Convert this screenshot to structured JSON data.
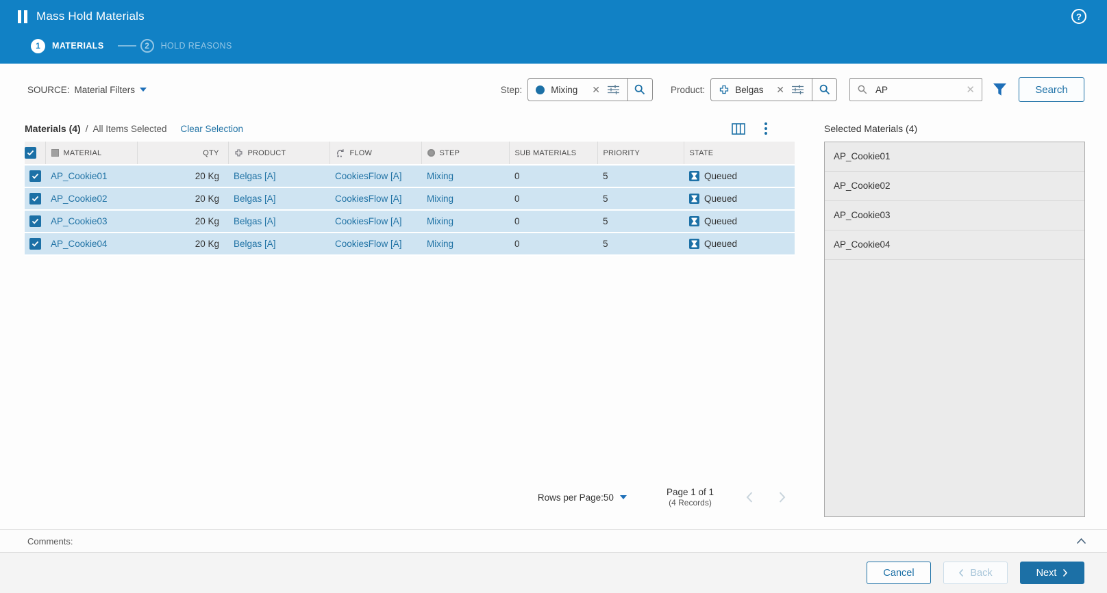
{
  "header": {
    "title": "Mass Hold Materials",
    "steps": [
      {
        "number": "1",
        "label": "MATERIALS"
      },
      {
        "number": "2",
        "label": "HOLD REASONS"
      }
    ],
    "help": "?"
  },
  "filters": {
    "source_label": "SOURCE:",
    "source_value": "Material Filters",
    "step_label": "Step:",
    "step_chip": "Mixing",
    "product_label": "Product:",
    "product_chip": "Belgas",
    "search_input_value": "AP",
    "search_button_label": "Search"
  },
  "materials_bar": {
    "title": "Materials (4)",
    "divider": "/",
    "status": "All Items Selected",
    "clear": "Clear Selection"
  },
  "table": {
    "columns": [
      "MATERIAL",
      "QTY",
      "PRODUCT",
      "FLOW",
      "STEP",
      "SUB MATERIALS",
      "PRIORITY",
      "STATE"
    ],
    "rows": [
      {
        "material": "AP_Cookie01",
        "qty": "20 Kg",
        "product": "Belgas [A]",
        "flow": "CookiesFlow [A]",
        "step": "Mixing",
        "sub_materials": "0",
        "priority": "5",
        "state": "Queued"
      },
      {
        "material": "AP_Cookie02",
        "qty": "20 Kg",
        "product": "Belgas [A]",
        "flow": "CookiesFlow [A]",
        "step": "Mixing",
        "sub_materials": "0",
        "priority": "5",
        "state": "Queued"
      },
      {
        "material": "AP_Cookie03",
        "qty": "20 Kg",
        "product": "Belgas [A]",
        "flow": "CookiesFlow [A]",
        "step": "Mixing",
        "sub_materials": "0",
        "priority": "5",
        "state": "Queued"
      },
      {
        "material": "AP_Cookie04",
        "qty": "20 Kg",
        "product": "Belgas [A]",
        "flow": "CookiesFlow [A]",
        "step": "Mixing",
        "sub_materials": "0",
        "priority": "5",
        "state": "Queued"
      }
    ]
  },
  "pagination": {
    "rows_per_page_label": "Rows per Page:",
    "rows_per_page_value": "50",
    "page_info": "Page 1 of 1",
    "records_info": "(4 Records)"
  },
  "selected_panel": {
    "title": "Selected Materials (4)",
    "items": [
      "AP_Cookie01",
      "AP_Cookie02",
      "AP_Cookie03",
      "AP_Cookie04"
    ]
  },
  "comments": {
    "label": "Comments:"
  },
  "footer": {
    "cancel_label": "Cancel",
    "back_label": "Back",
    "next_label": "Next"
  },
  "icons": {
    "pause-icon": "||",
    "help-icon": "?",
    "circle-icon": "filled-circle",
    "product-icon": "cross-manifold",
    "flow-icon": "circular-arrows",
    "step-icon": "filled-circle",
    "material-icon": "grey-square",
    "sliders-icon": "filter-settings",
    "search-icon": "magnifier",
    "funnel-icon": "filter-funnel",
    "columns-icon": "column-chooser",
    "kebab-icon": "more-options",
    "hourglass-icon": "queued-state",
    "checkbox-check-icon": "check",
    "chevron-icons": "pagination-and-wizard-navigation"
  },
  "colors": {
    "header_blue": "#1181c5",
    "accent_blue": "#1c70a6",
    "link_blue": "#2173a5",
    "funnel_blue": "#1e6fb8",
    "row_blue": "#cfe4f2",
    "table_header_grey": "#f0efef",
    "panel_grey": "#ebebeb",
    "footer_grey": "#f4f4f4"
  }
}
